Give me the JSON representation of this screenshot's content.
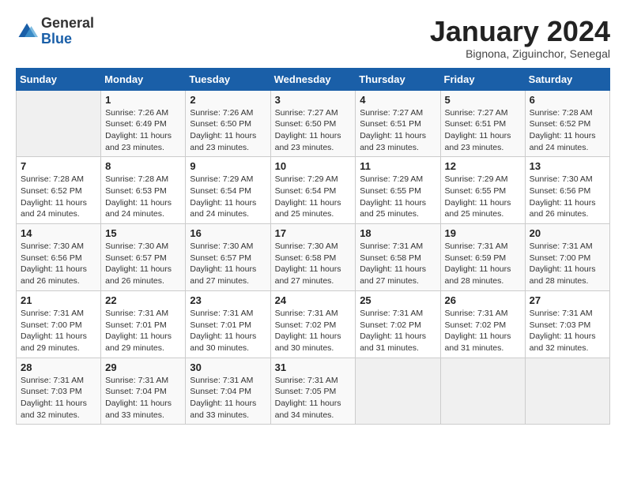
{
  "header": {
    "logo": {
      "general": "General",
      "blue": "Blue"
    },
    "title": "January 2024",
    "subtitle": "Bignona, Ziguinchor, Senegal"
  },
  "days_of_week": [
    "Sunday",
    "Monday",
    "Tuesday",
    "Wednesday",
    "Thursday",
    "Friday",
    "Saturday"
  ],
  "weeks": [
    [
      {
        "day": "",
        "info": ""
      },
      {
        "day": "1",
        "info": "Sunrise: 7:26 AM\nSunset: 6:49 PM\nDaylight: 11 hours and 23 minutes."
      },
      {
        "day": "2",
        "info": "Sunrise: 7:26 AM\nSunset: 6:50 PM\nDaylight: 11 hours and 23 minutes."
      },
      {
        "day": "3",
        "info": "Sunrise: 7:27 AM\nSunset: 6:50 PM\nDaylight: 11 hours and 23 minutes."
      },
      {
        "day": "4",
        "info": "Sunrise: 7:27 AM\nSunset: 6:51 PM\nDaylight: 11 hours and 23 minutes."
      },
      {
        "day": "5",
        "info": "Sunrise: 7:27 AM\nSunset: 6:51 PM\nDaylight: 11 hours and 23 minutes."
      },
      {
        "day": "6",
        "info": "Sunrise: 7:28 AM\nSunset: 6:52 PM\nDaylight: 11 hours and 24 minutes."
      }
    ],
    [
      {
        "day": "7",
        "info": "Sunrise: 7:28 AM\nSunset: 6:52 PM\nDaylight: 11 hours and 24 minutes."
      },
      {
        "day": "8",
        "info": "Sunrise: 7:28 AM\nSunset: 6:53 PM\nDaylight: 11 hours and 24 minutes."
      },
      {
        "day": "9",
        "info": "Sunrise: 7:29 AM\nSunset: 6:54 PM\nDaylight: 11 hours and 24 minutes."
      },
      {
        "day": "10",
        "info": "Sunrise: 7:29 AM\nSunset: 6:54 PM\nDaylight: 11 hours and 25 minutes."
      },
      {
        "day": "11",
        "info": "Sunrise: 7:29 AM\nSunset: 6:55 PM\nDaylight: 11 hours and 25 minutes."
      },
      {
        "day": "12",
        "info": "Sunrise: 7:29 AM\nSunset: 6:55 PM\nDaylight: 11 hours and 25 minutes."
      },
      {
        "day": "13",
        "info": "Sunrise: 7:30 AM\nSunset: 6:56 PM\nDaylight: 11 hours and 26 minutes."
      }
    ],
    [
      {
        "day": "14",
        "info": "Sunrise: 7:30 AM\nSunset: 6:56 PM\nDaylight: 11 hours and 26 minutes."
      },
      {
        "day": "15",
        "info": "Sunrise: 7:30 AM\nSunset: 6:57 PM\nDaylight: 11 hours and 26 minutes."
      },
      {
        "day": "16",
        "info": "Sunrise: 7:30 AM\nSunset: 6:57 PM\nDaylight: 11 hours and 27 minutes."
      },
      {
        "day": "17",
        "info": "Sunrise: 7:30 AM\nSunset: 6:58 PM\nDaylight: 11 hours and 27 minutes."
      },
      {
        "day": "18",
        "info": "Sunrise: 7:31 AM\nSunset: 6:58 PM\nDaylight: 11 hours and 27 minutes."
      },
      {
        "day": "19",
        "info": "Sunrise: 7:31 AM\nSunset: 6:59 PM\nDaylight: 11 hours and 28 minutes."
      },
      {
        "day": "20",
        "info": "Sunrise: 7:31 AM\nSunset: 7:00 PM\nDaylight: 11 hours and 28 minutes."
      }
    ],
    [
      {
        "day": "21",
        "info": "Sunrise: 7:31 AM\nSunset: 7:00 PM\nDaylight: 11 hours and 29 minutes."
      },
      {
        "day": "22",
        "info": "Sunrise: 7:31 AM\nSunset: 7:01 PM\nDaylight: 11 hours and 29 minutes."
      },
      {
        "day": "23",
        "info": "Sunrise: 7:31 AM\nSunset: 7:01 PM\nDaylight: 11 hours and 30 minutes."
      },
      {
        "day": "24",
        "info": "Sunrise: 7:31 AM\nSunset: 7:02 PM\nDaylight: 11 hours and 30 minutes."
      },
      {
        "day": "25",
        "info": "Sunrise: 7:31 AM\nSunset: 7:02 PM\nDaylight: 11 hours and 31 minutes."
      },
      {
        "day": "26",
        "info": "Sunrise: 7:31 AM\nSunset: 7:02 PM\nDaylight: 11 hours and 31 minutes."
      },
      {
        "day": "27",
        "info": "Sunrise: 7:31 AM\nSunset: 7:03 PM\nDaylight: 11 hours and 32 minutes."
      }
    ],
    [
      {
        "day": "28",
        "info": "Sunrise: 7:31 AM\nSunset: 7:03 PM\nDaylight: 11 hours and 32 minutes."
      },
      {
        "day": "29",
        "info": "Sunrise: 7:31 AM\nSunset: 7:04 PM\nDaylight: 11 hours and 33 minutes."
      },
      {
        "day": "30",
        "info": "Sunrise: 7:31 AM\nSunset: 7:04 PM\nDaylight: 11 hours and 33 minutes."
      },
      {
        "day": "31",
        "info": "Sunrise: 7:31 AM\nSunset: 7:05 PM\nDaylight: 11 hours and 34 minutes."
      },
      {
        "day": "",
        "info": ""
      },
      {
        "day": "",
        "info": ""
      },
      {
        "day": "",
        "info": ""
      }
    ]
  ]
}
